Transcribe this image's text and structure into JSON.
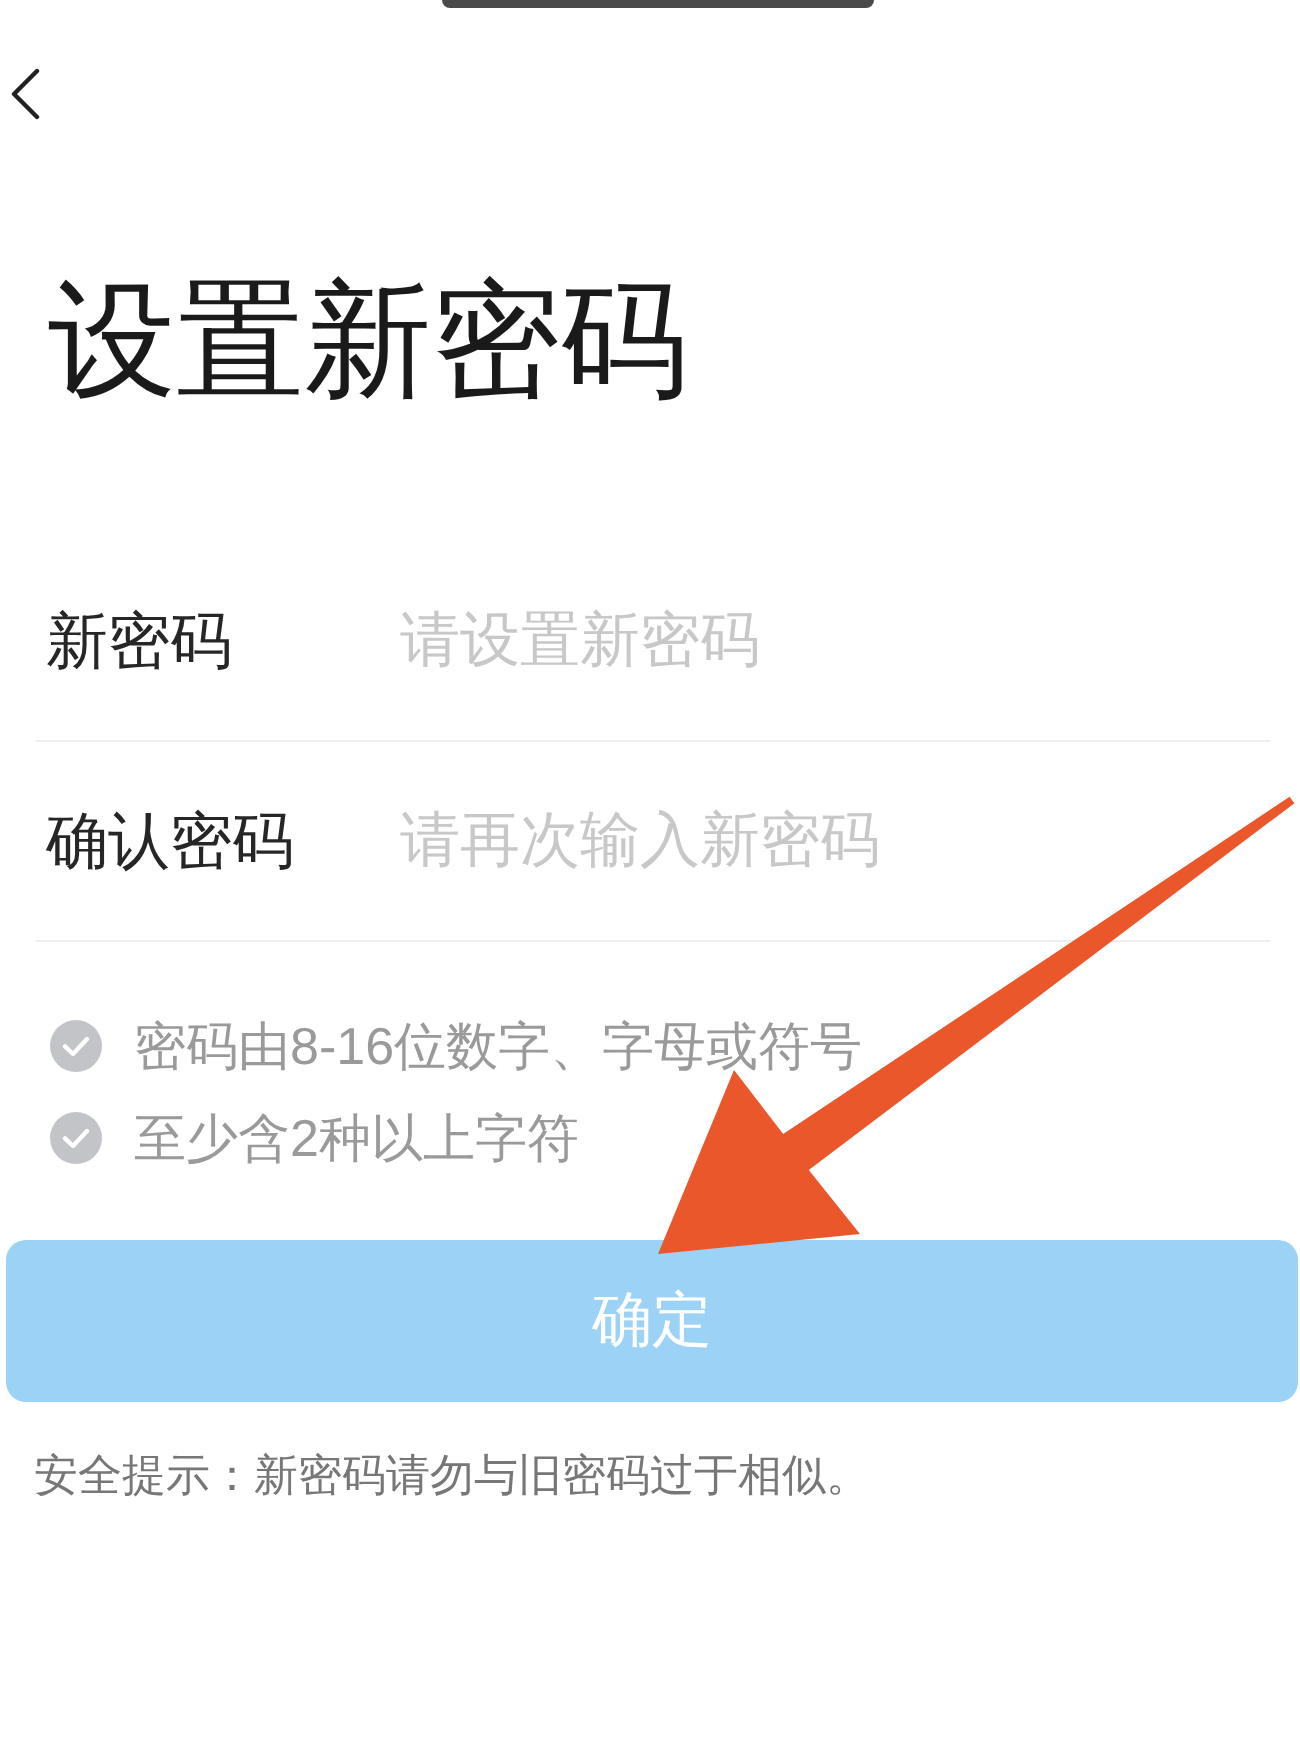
{
  "title": "设置新密码",
  "fields": [
    {
      "label": "新密码",
      "placeholder": "请设置新密码"
    },
    {
      "label": "确认密码",
      "placeholder": "请再次输入新密码"
    }
  ],
  "rules": [
    {
      "text": "密码由8-16位数字、字母或符号",
      "met": false
    },
    {
      "text": "至少含2种以上字符",
      "met": false
    }
  ],
  "confirm_button": {
    "label": "确定",
    "disabled": true
  },
  "security_tip": "安全提示：新密码请勿与旧密码过于相似。"
}
